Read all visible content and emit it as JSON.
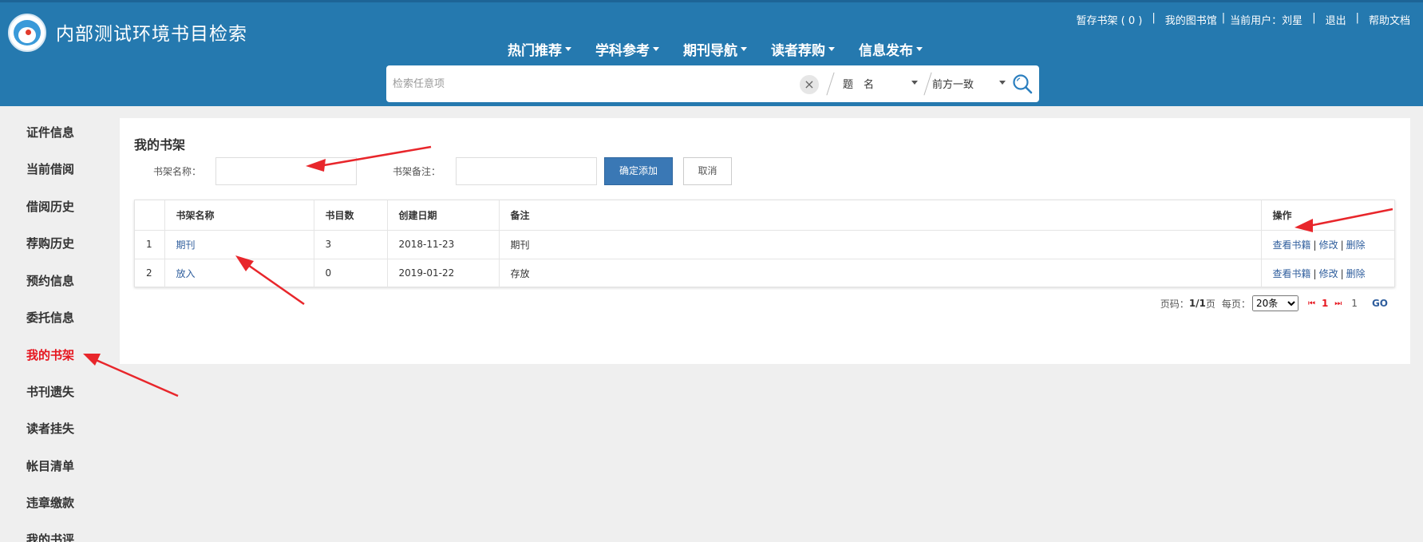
{
  "header": {
    "site_title": "内部测试环境书目检索",
    "top_links": {
      "temp_shelf": "暂存书架",
      "temp_shelf_count": "( 0 )",
      "my_library": "我的图书馆",
      "current_user_label": "当前用户：",
      "current_user_name": "刘星",
      "logout": "退出",
      "help": "帮助文档"
    },
    "nav": [
      {
        "label": "热门推荐"
      },
      {
        "label": "学科参考"
      },
      {
        "label": "期刊导航"
      },
      {
        "label": "读者荐购"
      },
      {
        "label": "信息发布"
      }
    ],
    "search": {
      "placeholder": "检索任意项",
      "field_selected": "题　名",
      "match_selected": "前方一致"
    }
  },
  "sidebar": {
    "items": [
      {
        "label": "证件信息"
      },
      {
        "label": "当前借阅"
      },
      {
        "label": "借阅历史"
      },
      {
        "label": "荐购历史"
      },
      {
        "label": "预约信息"
      },
      {
        "label": "委托信息"
      },
      {
        "label": "我的书架"
      },
      {
        "label": "书刊遗失"
      },
      {
        "label": "读者挂失"
      },
      {
        "label": "帐目清单"
      },
      {
        "label": "违章缴款"
      },
      {
        "label": "我的书评"
      }
    ],
    "active_index": 6
  },
  "panel": {
    "title": "我的书架",
    "form": {
      "name_label": "书架名称：",
      "note_label": "书架备注：",
      "confirm_label": "确定添加",
      "cancel_label": "取消"
    },
    "table": {
      "headers": [
        "",
        "书架名称",
        "书目数",
        "创建日期",
        "备注",
        "操作"
      ],
      "rows": [
        {
          "idx": "1",
          "name": "期刊",
          "count": "3",
          "date": "2018-11-23",
          "note": "期刊"
        },
        {
          "idx": "2",
          "name": "放入",
          "count": "0",
          "date": "2019-01-22",
          "note": "存放"
        }
      ],
      "ops": {
        "view": "查看书籍",
        "edit": "修改",
        "delete": "删除",
        "sep": "|"
      }
    },
    "pager": {
      "page_label": "页码：",
      "page_value": "1/1",
      "page_suffix": "页",
      "per_page_label": "每页：",
      "per_page_selected": "20条",
      "current_page": "1",
      "goto_value": "1",
      "go_label": "GO"
    }
  },
  "colors": {
    "header_bg": "#2579af",
    "active_sidebar": "#e6161f",
    "link": "#2f5e9d",
    "primary_button": "#3a78b5",
    "annotation_arrow": "#e8262b"
  }
}
